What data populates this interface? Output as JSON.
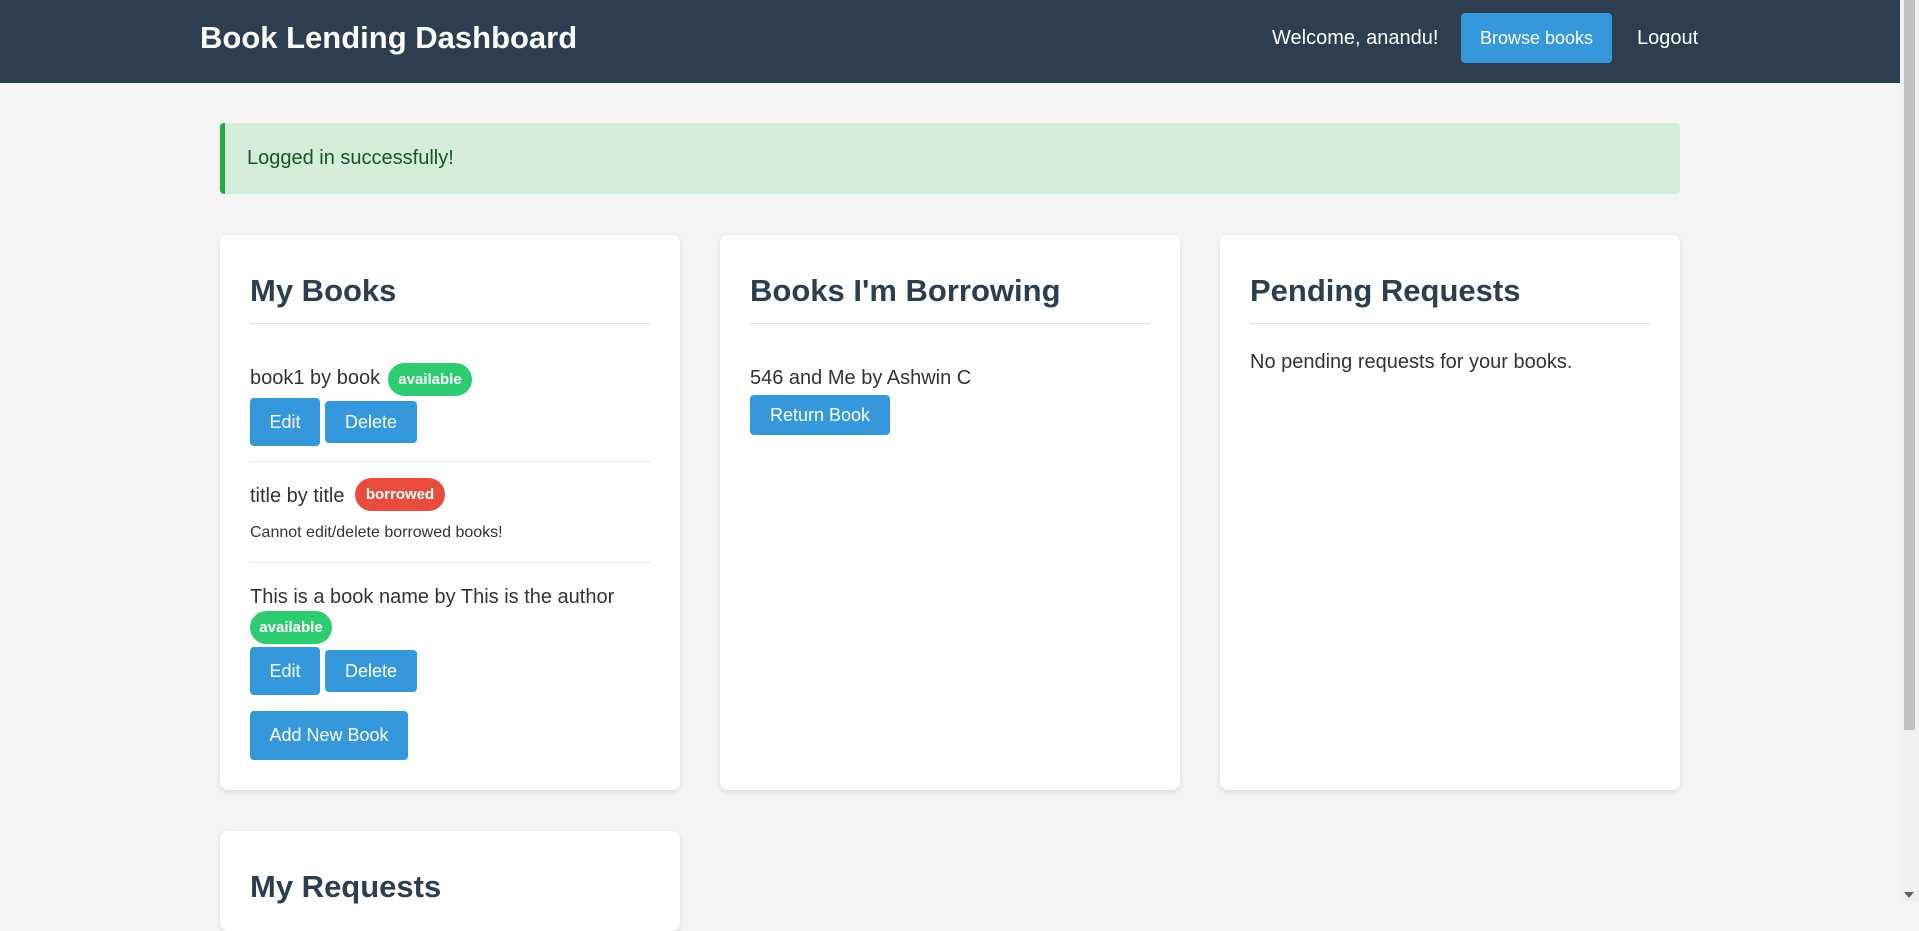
{
  "header": {
    "title": "Book Lending Dashboard",
    "welcome": "Welcome, anandu!",
    "browse_label": "Browse books",
    "logout_label": "Logout"
  },
  "alert": {
    "message": "Logged in successfully!"
  },
  "my_books": {
    "title": "My Books",
    "items": [
      {
        "text": "book1 by book",
        "status": "available",
        "edit_label": "Edit",
        "delete_label": "Delete"
      },
      {
        "text": "title by title",
        "status": "borrowed",
        "note": "Cannot edit/delete borrowed books!"
      },
      {
        "text": "This is a book name by This is the author",
        "status": "available",
        "edit_label": "Edit",
        "delete_label": "Delete"
      }
    ],
    "add_label": "Add New Book"
  },
  "borrowing": {
    "title": "Books I'm Borrowing",
    "items": [
      {
        "text": "546 and Me by Ashwin C",
        "return_label": "Return Book"
      }
    ]
  },
  "pending": {
    "title": "Pending Requests",
    "empty_text": "No pending requests for your books."
  },
  "my_requests": {
    "title": "My Requests"
  },
  "colors": {
    "navbar": "#2c3e50",
    "accent": "#3498db",
    "available": "#2ecc71",
    "borrowed": "#e74c3c",
    "alert_bg": "#d4edda"
  }
}
